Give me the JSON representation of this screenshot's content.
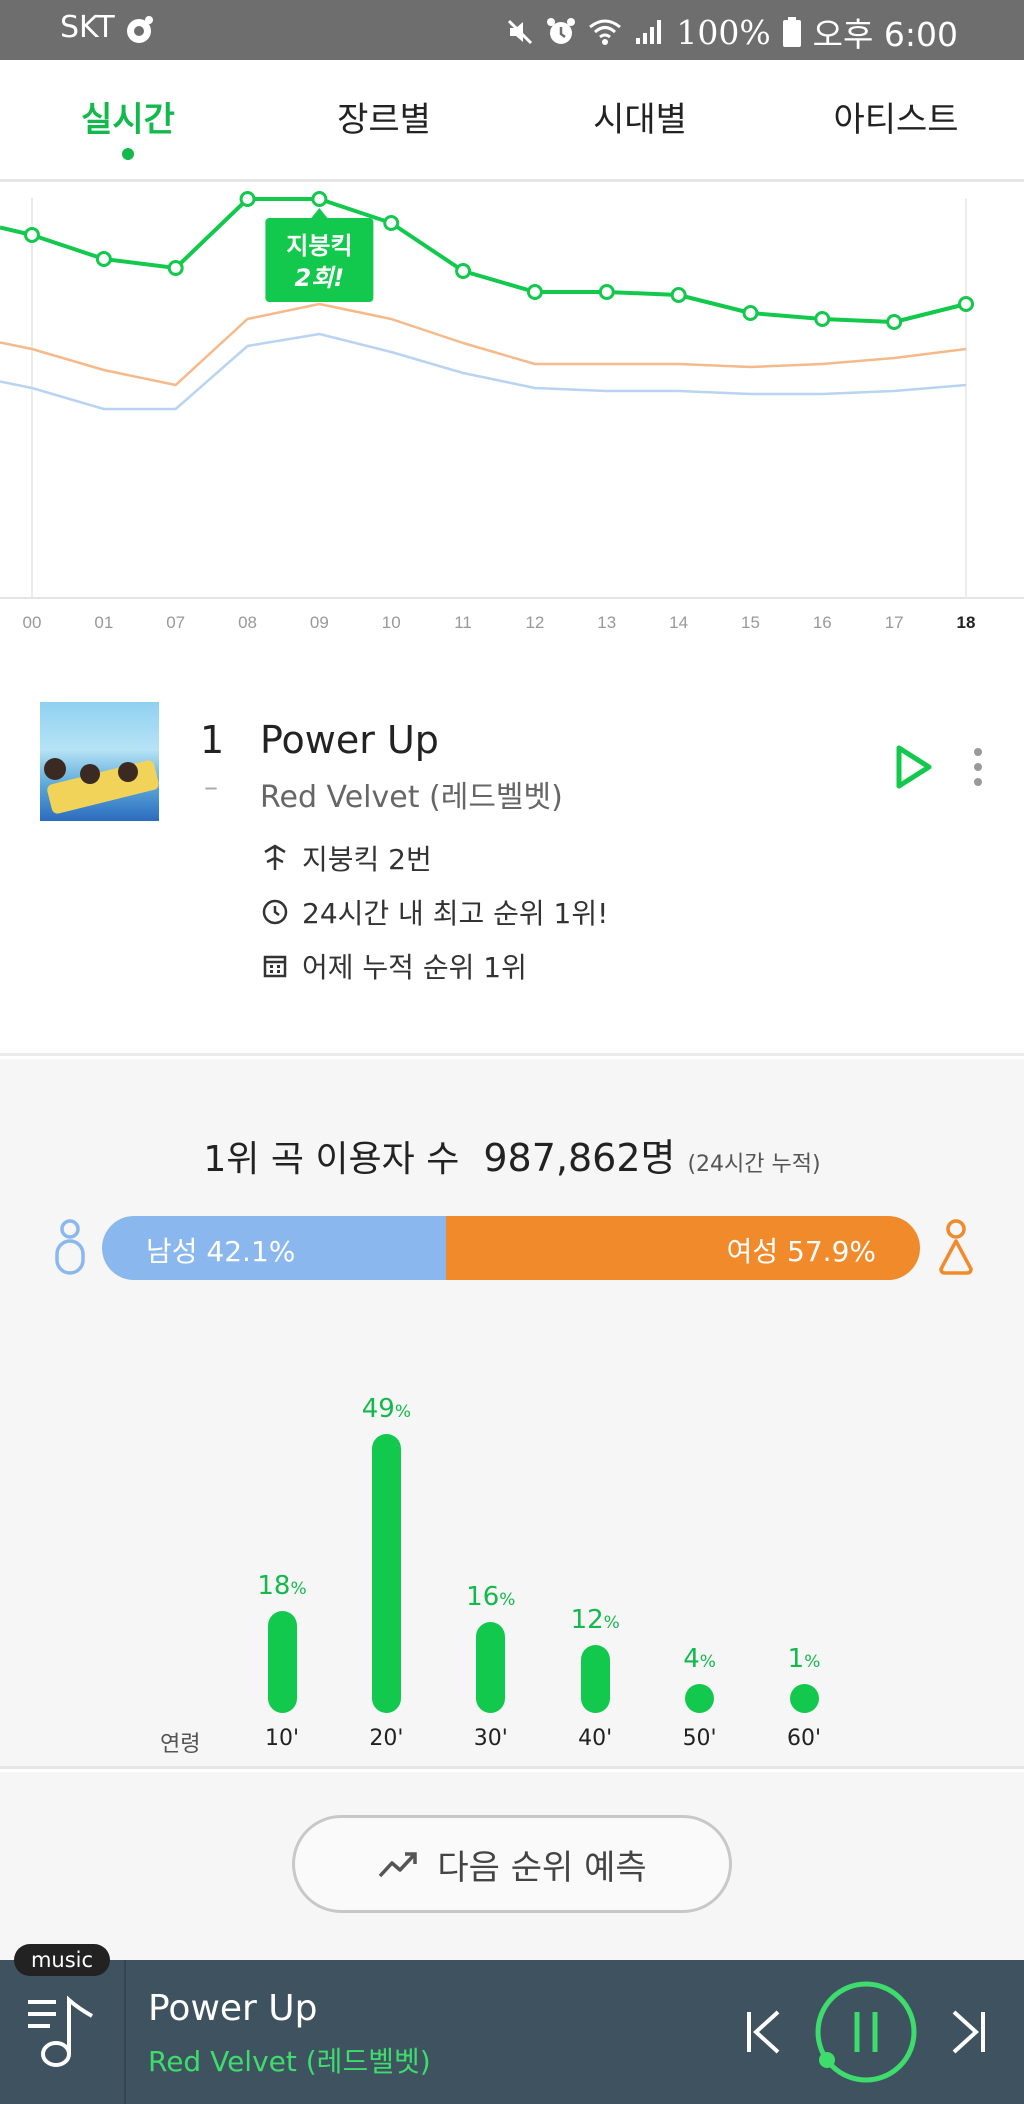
{
  "status_bar": {
    "carrier": "SKT",
    "battery": "100%",
    "time": "오후 6:00",
    "icons": [
      "mute-icon",
      "alarm-icon",
      "wifi-icon",
      "signal-icon",
      "battery-icon"
    ]
  },
  "tabs": [
    {
      "label": "실시간",
      "active": true
    },
    {
      "label": "장르별",
      "active": false
    },
    {
      "label": "시대별",
      "active": false
    },
    {
      "label": "아티스트",
      "active": false
    }
  ],
  "chart_data": {
    "type": "line",
    "categories": [
      "00",
      "01",
      "07",
      "08",
      "09",
      "10",
      "11",
      "12",
      "13",
      "14",
      "15",
      "16",
      "17",
      "18"
    ],
    "series": [
      {
        "values": [
          1.2,
          2.0,
          2.3,
          0.0,
          0.0,
          0.8,
          2.4,
          3.1,
          3.1,
          3.2,
          3.8,
          4.0,
          4.1,
          3.5
        ],
        "color": "#13c94d"
      },
      {
        "values": [
          5.0,
          5.7,
          6.2,
          4.0,
          3.5,
          4.0,
          4.8,
          5.5,
          5.5,
          5.5,
          5.6,
          5.5,
          5.3,
          5.0
        ],
        "color": "#f5b98a"
      },
      {
        "values": [
          6.3,
          7.0,
          7.0,
          4.9,
          4.5,
          5.1,
          5.8,
          6.3,
          6.4,
          6.4,
          6.5,
          6.5,
          6.4,
          6.2
        ],
        "color": "#b9d3f2"
      }
    ],
    "annotation": {
      "text_line1": "지붕킥",
      "text_line2": "2회!",
      "at": "09"
    },
    "y_inverted": true
  },
  "song": {
    "rank": "1",
    "rank_change": "–",
    "title": "Power Up",
    "artist": "Red Velvet (레드벨벳)",
    "info": [
      {
        "icon": "roof-kick-icon",
        "text": "지붕킥 2번"
      },
      {
        "icon": "clock-icon",
        "text": "24시간 내 최고 순위 1위!"
      },
      {
        "icon": "calendar-icon",
        "text": "어제 누적 순위 1위"
      }
    ]
  },
  "stats": {
    "label": "1위 곡 이용자 수",
    "count": "987,862명",
    "note": "(24시간 누적)",
    "male_label": "남성 42.1%",
    "female_label": "여성 57.9%",
    "male_pct": 42.1,
    "female_pct": 57.9,
    "male_color": "#8ab8ee",
    "female_color": "#f08a2a",
    "age_axis_label": "연령",
    "ages": [
      {
        "label": "10'",
        "value": 18,
        "pct_text": "18",
        "unit": "%"
      },
      {
        "label": "20'",
        "value": 49,
        "pct_text": "49",
        "unit": "%"
      },
      {
        "label": "30'",
        "value": 16,
        "pct_text": "16",
        "unit": "%"
      },
      {
        "label": "40'",
        "value": 12,
        "pct_text": "12",
        "unit": "%"
      },
      {
        "label": "50'",
        "value": 4,
        "pct_text": "4",
        "unit": "%"
      },
      {
        "label": "60'",
        "value": 1,
        "pct_text": "1",
        "unit": "%"
      }
    ]
  },
  "predict_button": {
    "label": "다음 순위 예측",
    "icon": "trend-up-icon"
  },
  "player": {
    "badge": "music",
    "title": "Power Up",
    "artist": "Red Velvet (레드벨벳)",
    "accent": "#3ddc6c"
  }
}
